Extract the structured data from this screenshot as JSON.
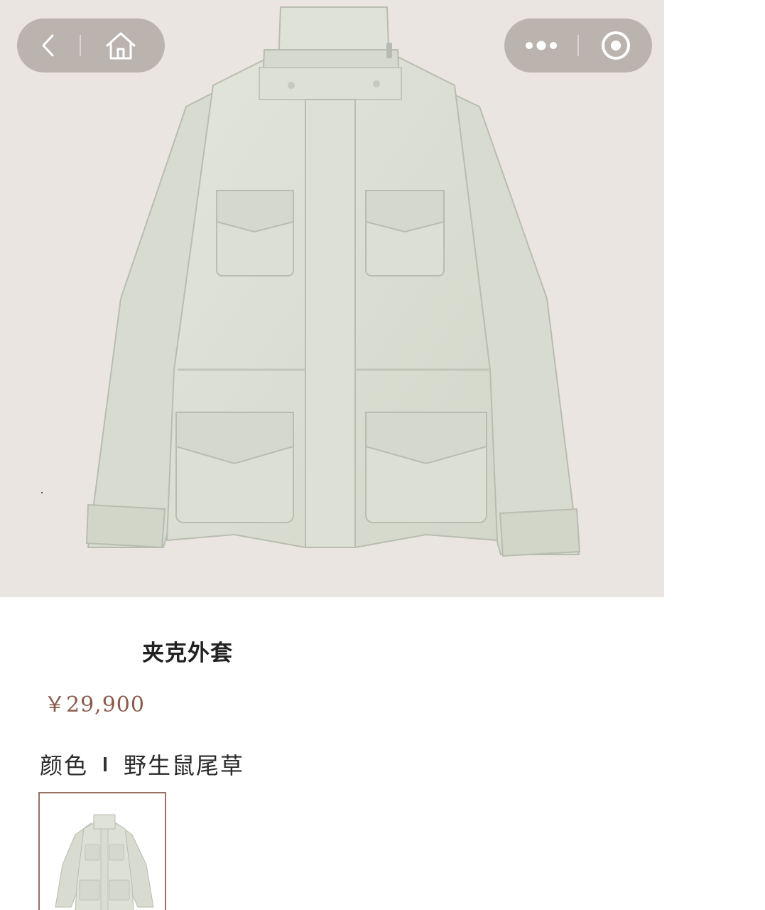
{
  "nav": {
    "back_icon": "chevron-left-icon",
    "home_icon": "home-icon",
    "more_icon": "more-dots-icon",
    "close_icon": "target-circle-icon"
  },
  "product": {
    "image_subject": "jacket",
    "title": "夹克外套",
    "price": "￥29,900",
    "color_label": "颜色",
    "color_value": "野生鼠尾草",
    "swatch_color": "#dcdfd2"
  },
  "colors": {
    "hero_bg": "#ebe5e1",
    "capsule_bg": "#ada59f",
    "price": "#8a5a4c",
    "swatch_border": "#9a6f62"
  }
}
